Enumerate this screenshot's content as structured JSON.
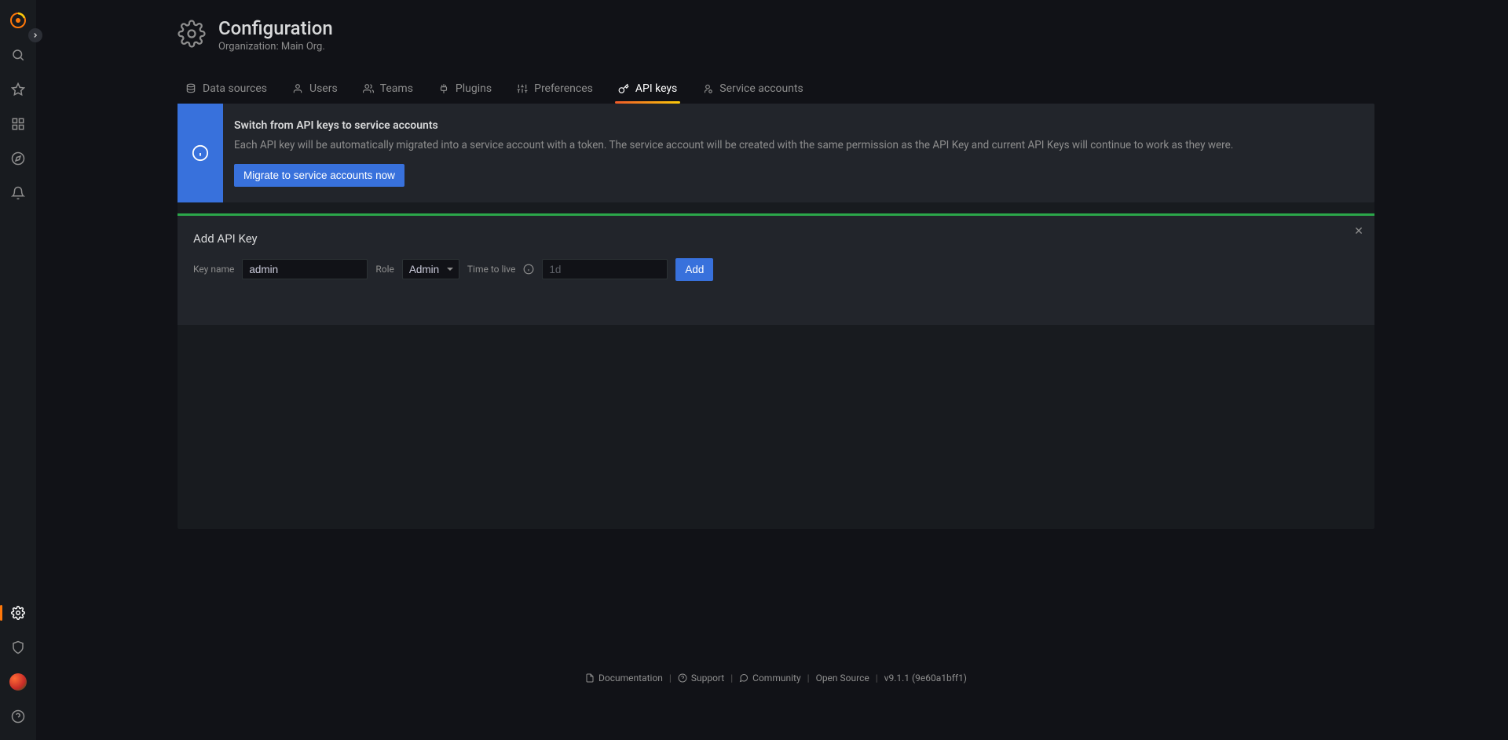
{
  "sidebar": {
    "items": [
      "logo",
      "search",
      "starred",
      "panels",
      "explore",
      "alerting"
    ],
    "bottom_items": [
      "config",
      "admin",
      "avatar",
      "help"
    ]
  },
  "header": {
    "title": "Configuration",
    "subtitle": "Organization: Main Org."
  },
  "tabs": [
    {
      "id": "data-sources",
      "label": "Data sources"
    },
    {
      "id": "users",
      "label": "Users"
    },
    {
      "id": "teams",
      "label": "Teams"
    },
    {
      "id": "plugins",
      "label": "Plugins"
    },
    {
      "id": "preferences",
      "label": "Preferences"
    },
    {
      "id": "api-keys",
      "label": "API keys",
      "active": true
    },
    {
      "id": "service-accounts",
      "label": "Service accounts"
    }
  ],
  "banner": {
    "title": "Switch from API keys to service accounts",
    "desc": "Each API key will be automatically migrated into a service account with a token. The service account will be created with the same permission as the API Key and current API Keys will continue to work as they were.",
    "button": "Migrate to service accounts now"
  },
  "add_panel": {
    "title": "Add API Key",
    "key_name_label": "Key name",
    "key_name_value": "admin",
    "role_label": "Role",
    "role_value": "Admin",
    "ttl_label": "Time to live",
    "ttl_placeholder": "1d",
    "add_button": "Add"
  },
  "footer": {
    "documentation": "Documentation",
    "support": "Support",
    "community": "Community",
    "open_source": "Open Source",
    "version": "v9.1.1 (9e60a1bff1)"
  }
}
